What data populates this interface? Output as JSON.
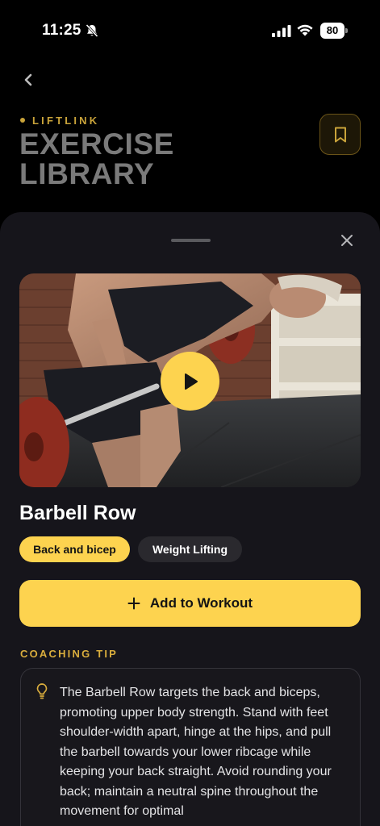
{
  "status": {
    "time": "11:25",
    "battery": "80"
  },
  "header": {
    "brand": "LIFTLINK",
    "title": "EXERCISE LIBRARY"
  },
  "exercise": {
    "title": "Barbell Row",
    "tags": [
      "Back and bicep",
      "Weight Lifting"
    ],
    "add_label": "Add to Workout",
    "coaching_label": "COACHING TIP",
    "coaching_tip": "The Barbell Row targets the back and biceps, promoting upper body strength. Stand with feet shoulder-width apart, hinge at the hips, and pull the barbell towards your lower ribcage while keeping your back straight. Avoid rounding your back; maintain a neutral spine throughout the movement for optimal"
  },
  "colors": {
    "accent": "#fdd34f",
    "brand_gold": "#c9a33a",
    "sheet_bg": "#16151b"
  },
  "icons": [
    "bell-slash-icon",
    "cellular-signal-icon",
    "wifi-icon",
    "chevron-left-icon",
    "bookmark-icon",
    "close-icon",
    "play-icon",
    "plus-icon",
    "lightbulb-icon"
  ]
}
